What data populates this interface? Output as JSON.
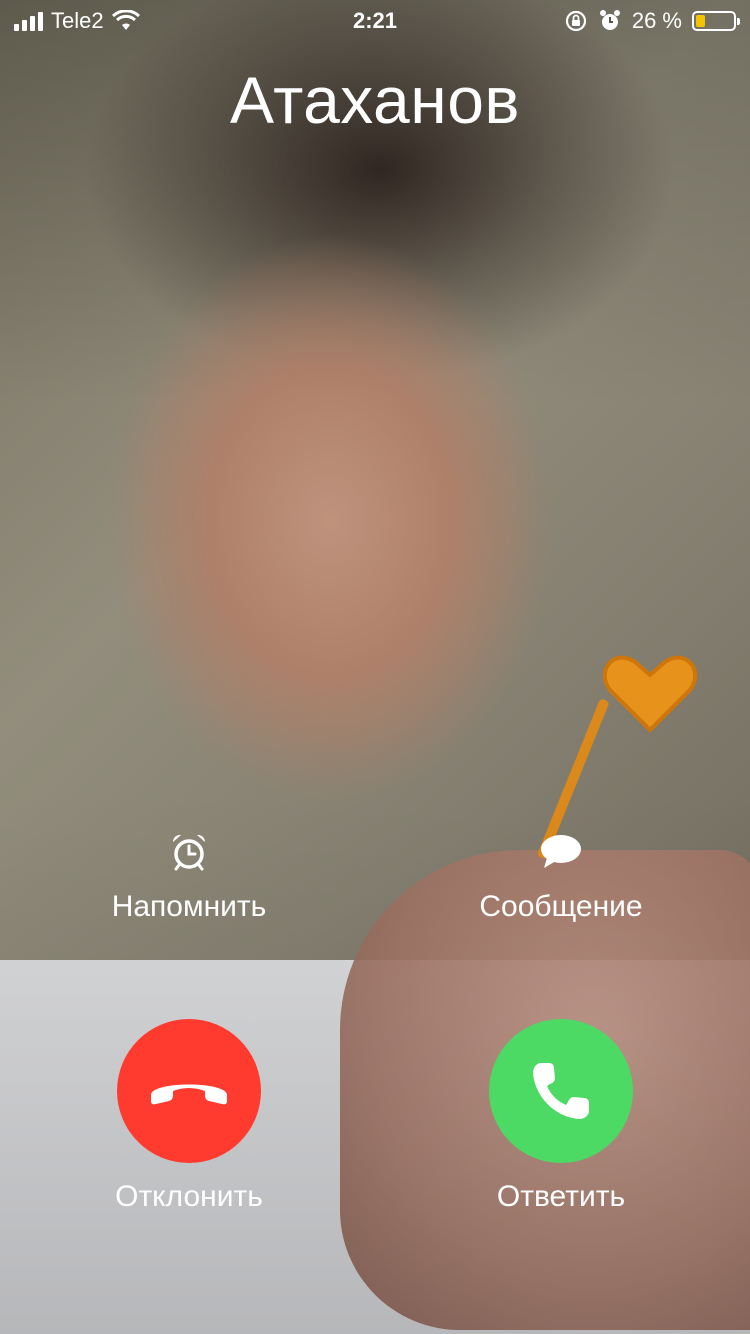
{
  "status_bar": {
    "carrier": "Tele2",
    "time": "2:21",
    "battery_percent": "26 %",
    "battery_level": 0.26,
    "icons": [
      "signal-icon",
      "wifi-icon",
      "orientation-lock-icon",
      "alarm-icon",
      "battery-icon"
    ]
  },
  "call": {
    "caller_name": "Атаханов"
  },
  "actions": {
    "remind_label": "Напомнить",
    "message_label": "Сообщение"
  },
  "buttons": {
    "decline_label": "Отклонить",
    "answer_label": "Ответить"
  },
  "colors": {
    "decline": "#ff3b30",
    "answer": "#4cd964"
  }
}
